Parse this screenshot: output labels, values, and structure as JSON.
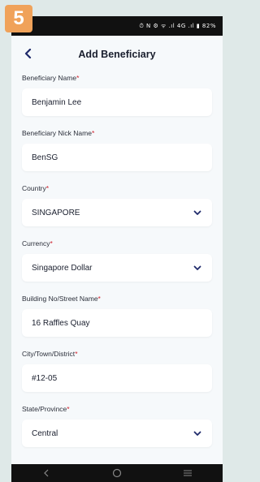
{
  "step_number": "5",
  "status_bar": {
    "text": "⏱ N ⚙ ᯤ .ıl 4G .ıl ▮ 82%"
  },
  "header": {
    "title": "Add Beneficiary"
  },
  "fields": [
    {
      "label": "Beneficiary Name",
      "required_mark": "*",
      "value": "Benjamin Lee",
      "type": "text"
    },
    {
      "label": "Beneficiary Nick Name",
      "required_mark": "*",
      "value": "BenSG",
      "type": "text"
    },
    {
      "label": "Country",
      "required_mark": "*",
      "value": "SINGAPORE",
      "type": "select"
    },
    {
      "label": "Currency",
      "required_mark": "*",
      "value": "Singapore Dollar",
      "type": "select"
    },
    {
      "label": "Building No/Street Name",
      "required_mark": "*",
      "value": "16 Raffles Quay",
      "type": "text"
    },
    {
      "label": "City/Town/District",
      "required_mark": "*",
      "value": "#12-05",
      "type": "text"
    },
    {
      "label": "State/Province",
      "required_mark": "*",
      "value": "Central",
      "type": "select"
    }
  ],
  "colors": {
    "accent": "#1f2a6b",
    "required": "#d0202c",
    "badge": "#f0a25a"
  },
  "icons": {
    "back": "chevron-left-icon",
    "select": "chevron-down-icon"
  }
}
